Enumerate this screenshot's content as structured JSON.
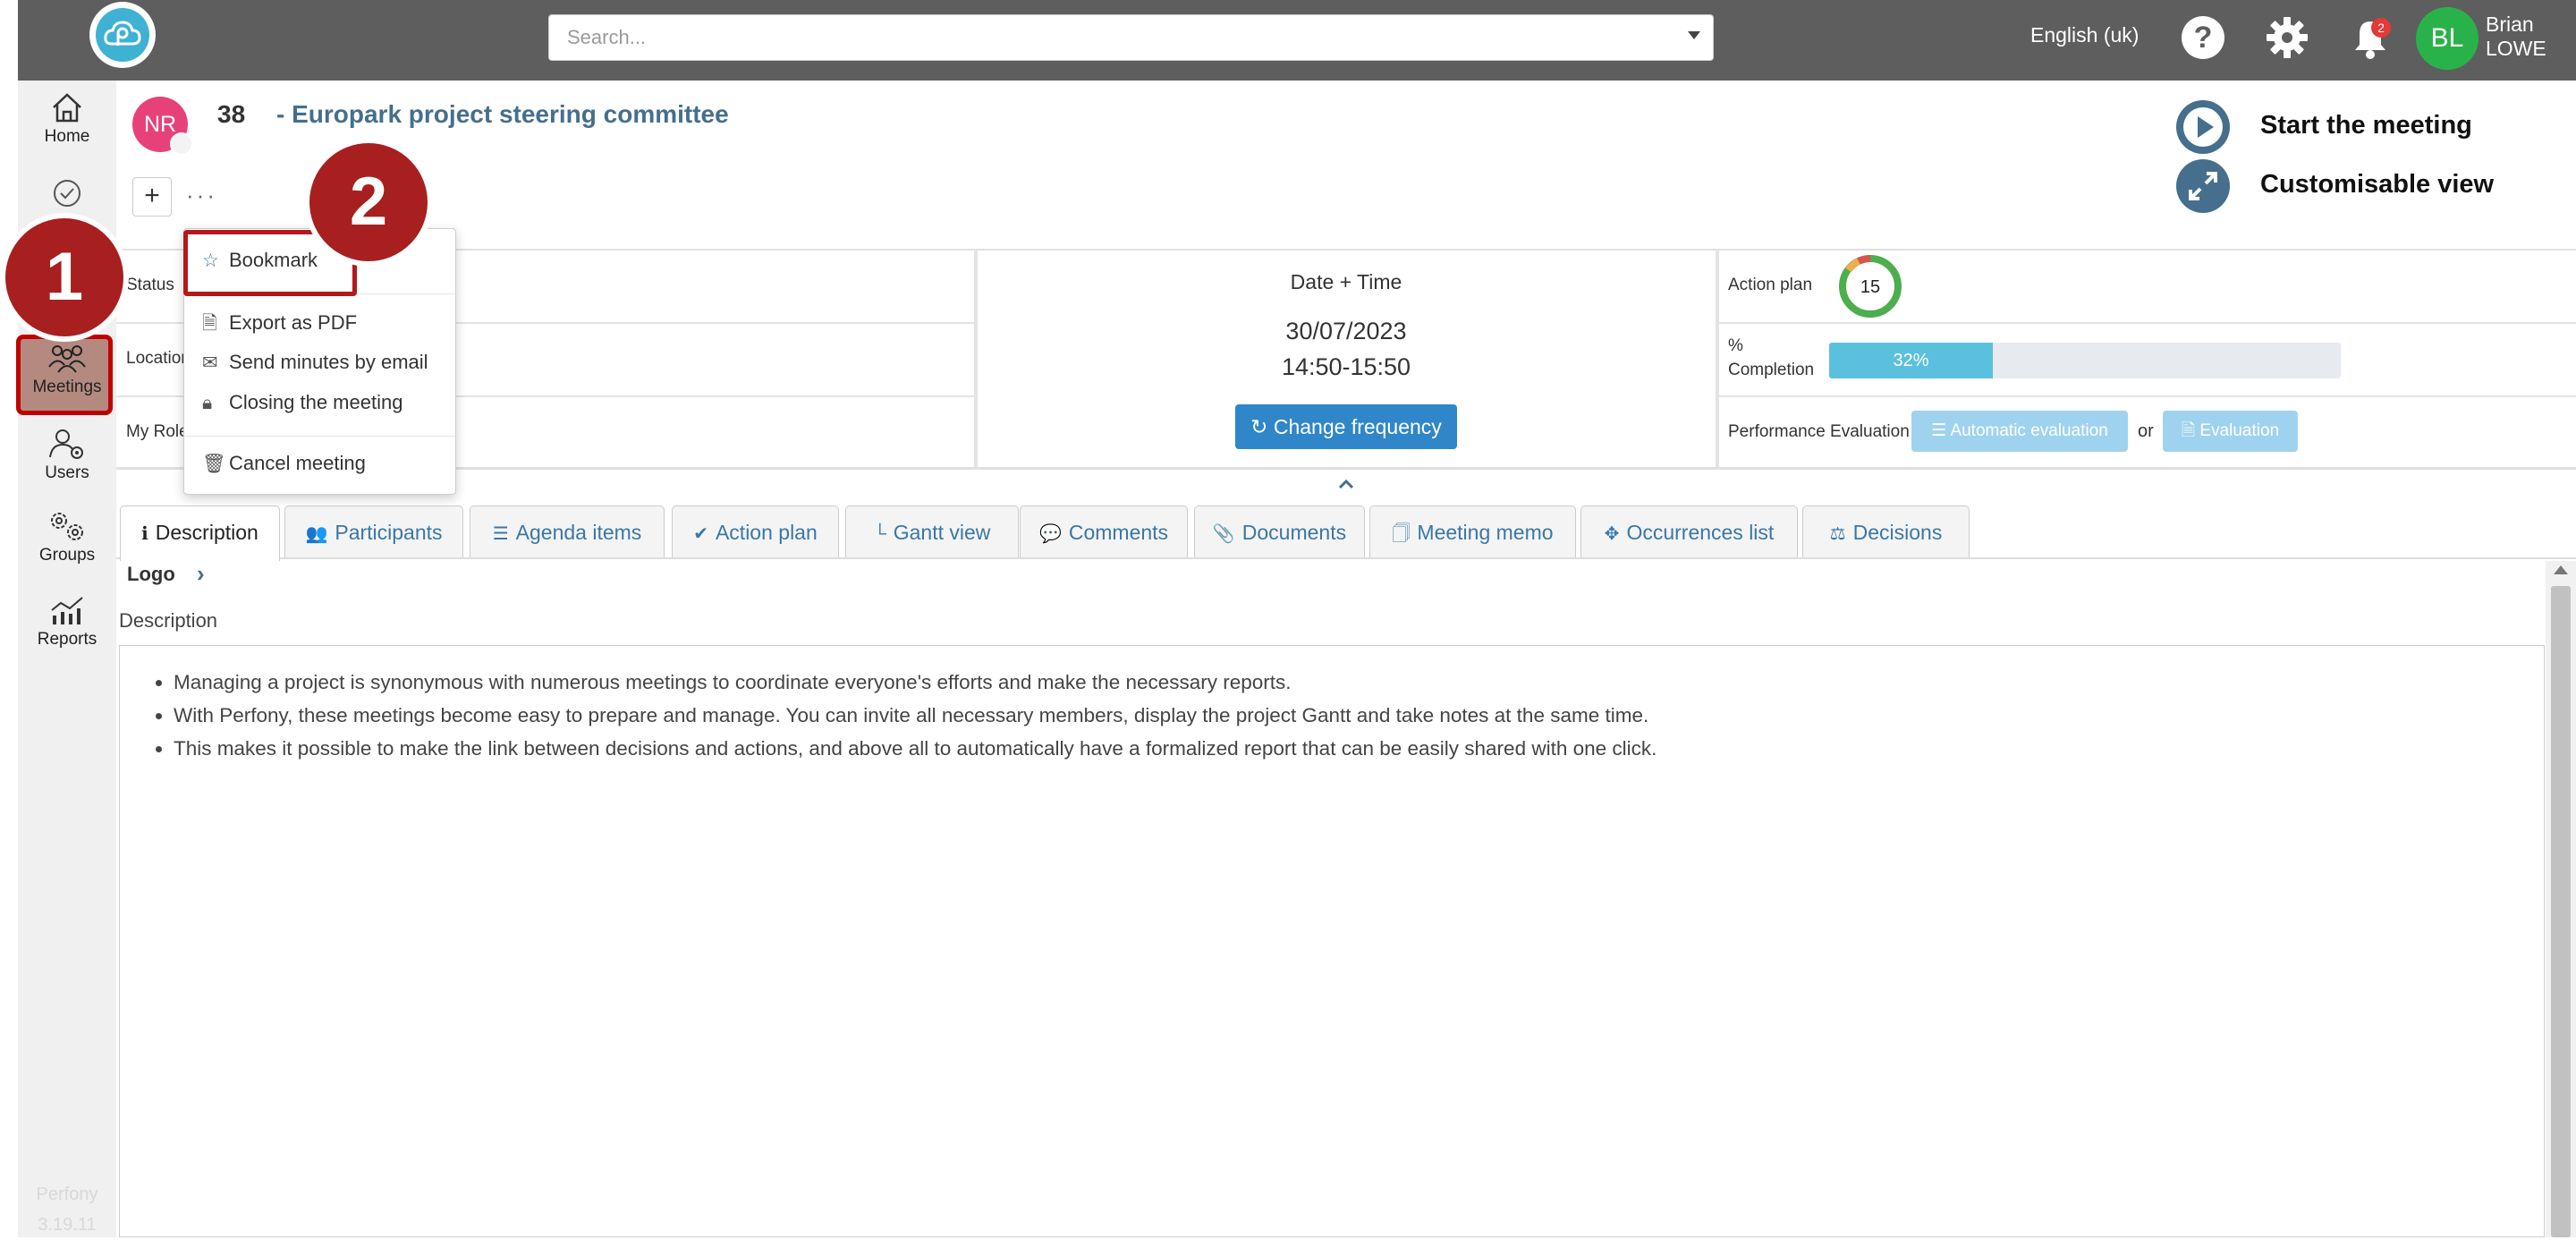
{
  "topbar": {
    "search_placeholder": "Search...",
    "language": "English (uk)",
    "help_label": "?",
    "notification_count": "2",
    "user_initials": "BL",
    "user_first": "Brian",
    "user_last": "LOWE"
  },
  "sidebar": {
    "items": [
      {
        "label": "Home"
      },
      {
        "label": "Meetings"
      },
      {
        "label": "Users"
      },
      {
        "label": "Groups"
      },
      {
        "label": "Reports"
      }
    ],
    "app_name": "Perfony",
    "version": "3.19.11"
  },
  "meeting": {
    "avatar_initials": "NR",
    "number": "38",
    "title": "- Europark project steering committee",
    "plus_label": "+",
    "more_label": "···",
    "start_label": "Start the meeting",
    "custom_label": "Customisable view"
  },
  "info": {
    "status_label": "Status",
    "location_label": "Location",
    "role_label": "My Role",
    "datetime_title": "Date + Time",
    "date": "30/07/2023",
    "time": "14:50-15:50",
    "change_frequency": "Change frequency",
    "action_plan_label": "Action plan",
    "action_plan_count": "15",
    "completion_label_1": "%",
    "completion_label_2": "Completion",
    "completion_value": "32%",
    "completion_fraction": 0.32,
    "performance_label": "Performance Evaluation :",
    "auto_eval": "Automatic evaluation",
    "or_label": "or",
    "eval": "Evaluation"
  },
  "tabs": [
    {
      "label": "Description",
      "icon": "info-icon"
    },
    {
      "label": "Participants",
      "icon": "users-icon"
    },
    {
      "label": "Agenda items",
      "icon": "list-icon"
    },
    {
      "label": "Action plan",
      "icon": "check-circle-icon"
    },
    {
      "label": "Gantt view",
      "icon": "chart-icon"
    },
    {
      "label": "Comments",
      "icon": "comments-icon"
    },
    {
      "label": "Documents",
      "icon": "paperclip-icon"
    },
    {
      "label": "Meeting memo",
      "icon": "memo-icon"
    },
    {
      "label": "Occurrences list",
      "icon": "arrows-icon"
    },
    {
      "label": "Decisions",
      "icon": "scale-icon"
    }
  ],
  "content": {
    "logo_label": "Logo",
    "description_label": "Description",
    "bullets": [
      "Managing a project is synonymous with numerous meetings to coordinate everyone's efforts and make the necessary reports.",
      "With Perfony, these meetings become easy to prepare and manage. You can invite all necessary members, display the project Gantt and take notes at the same time.",
      "This makes it possible to make the link between decisions and actions, and above all to automatically have a formalized report that can be easily shared with one click."
    ]
  },
  "menu": {
    "bookmark": "Bookmark",
    "export_pdf": "Export as PDF",
    "send_minutes": "Send minutes by email",
    "closing": "Closing the meeting",
    "cancel": "Cancel meeting"
  },
  "steps": {
    "step1": "1",
    "step2": "2"
  },
  "colors": {
    "topbar": "#5e5e5e",
    "accent": "#456f8c",
    "primary_button": "#2f86c9",
    "step_badge": "#a71f1f",
    "user_avatar": "#2ab24a"
  }
}
